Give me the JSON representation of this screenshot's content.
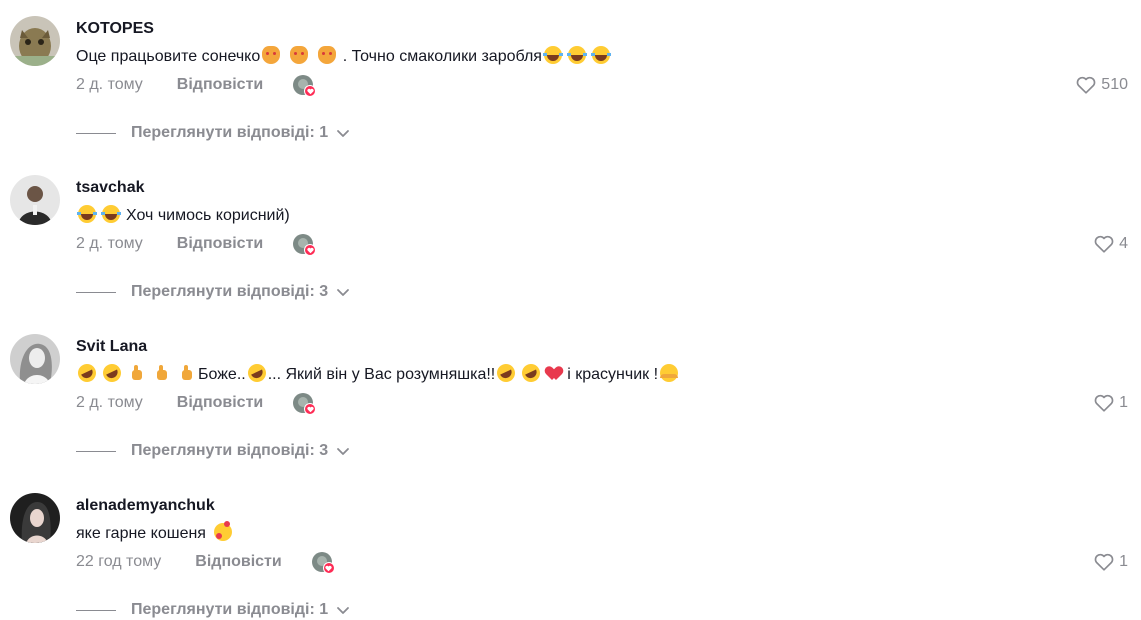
{
  "comments": [
    {
      "username": "KOTOPES",
      "text_parts": [
        "Оце працьовите сонечко",
        " . Точно смаколики заробля"
      ],
      "time": "2 д. тому",
      "reply_label": "Відповісти",
      "likes": "510",
      "view_replies": "Переглянути відповіді: 1",
      "avatar_color": "#8a7a52"
    },
    {
      "username": "tsavchak",
      "text_parts": [
        "Хоч чимось корисний)"
      ],
      "time": "2 д. тому",
      "reply_label": "Відповісти",
      "likes": "4",
      "view_replies": "Переглянути відповіді: 3",
      "avatar_color": "#d9d9d9"
    },
    {
      "username": "Svit Lana",
      "text_parts": [
        "Боже..",
        "... Який він у Вас розумняшка!!",
        "і красунчик !"
      ],
      "time": "2 д. тому",
      "reply_label": "Відповісти",
      "likes": "1",
      "view_replies": "Переглянути відповіді: 3",
      "avatar_color": "#bdbdbd"
    },
    {
      "username": "alenademyanchuk",
      "text_parts": [
        "яке гарне кошеня"
      ],
      "time": "22 год тому",
      "reply_label": "Відповісти",
      "likes": "1",
      "view_replies": "Переглянути відповіді: 1",
      "avatar_color": "#2b2b2b"
    }
  ],
  "icons": {
    "like": "heart-outline-icon",
    "creator_like": "creator-liked-icon",
    "expand": "chevron-down-icon"
  },
  "colors": {
    "text": "#161823",
    "muted": "#8a8b91",
    "accent": "#fe2c55"
  }
}
